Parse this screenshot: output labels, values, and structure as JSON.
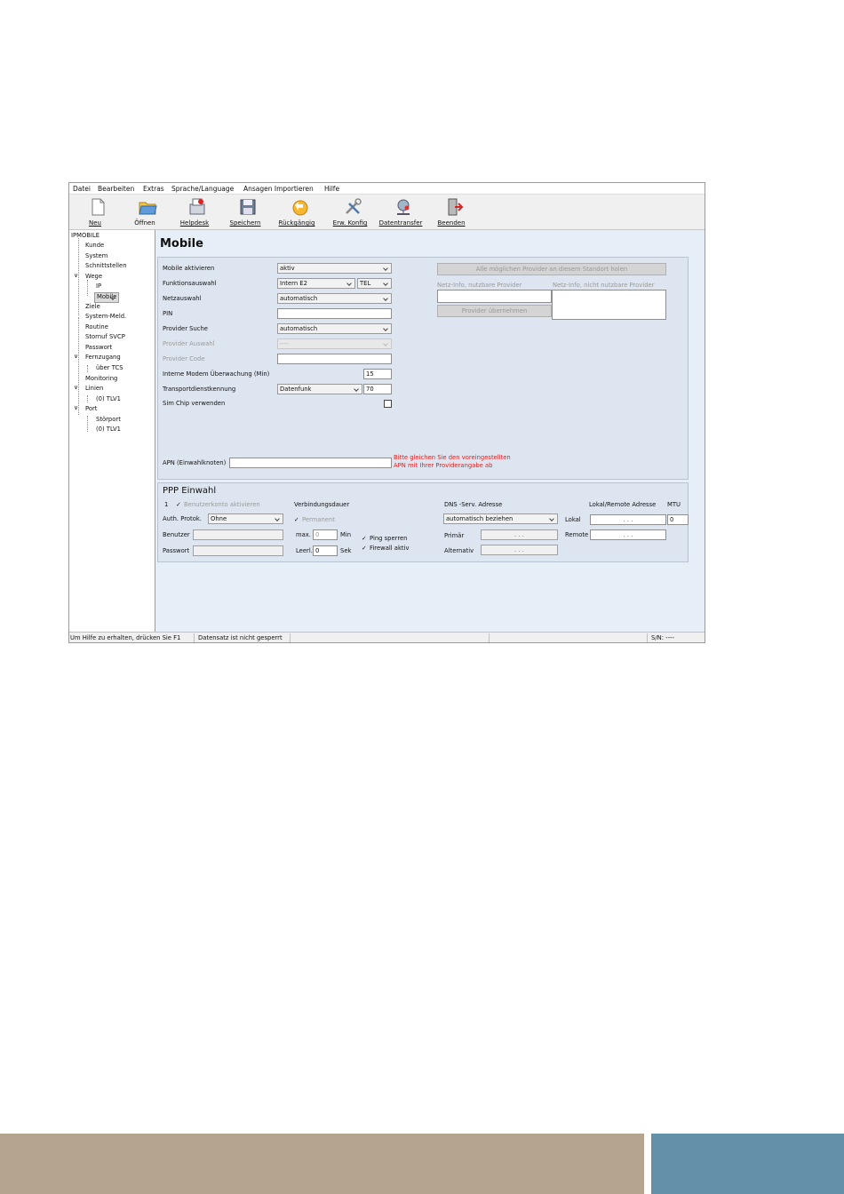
{
  "menu": [
    "Datei",
    "Bearbeiten",
    "Extras",
    "Sprache/Language",
    "Ansagen Importieren",
    "Hilfe"
  ],
  "toolbar": [
    {
      "icon": "new-document-icon",
      "label": "Neu"
    },
    {
      "icon": "open-folder-icon",
      "label": "Öffnen"
    },
    {
      "icon": "helpdesk-icon",
      "label": "Helpdesk"
    },
    {
      "icon": "save-disk-icon",
      "label": "Speichern"
    },
    {
      "icon": "undo-icon",
      "label": "Rückgängig"
    },
    {
      "icon": "tools-icon",
      "label": "Erw. Konfig"
    },
    {
      "icon": "data-transfer-icon",
      "label": "Datentransfer"
    },
    {
      "icon": "exit-door-icon",
      "label": "Beenden"
    }
  ],
  "tree": {
    "root": "IPMOBILE",
    "kunde": "Kunde",
    "system": "System",
    "schnittstellen": "Schnittstellen",
    "wege": "Wege",
    "ip": "IP",
    "mobile": "Mobile",
    "ziele": "Ziele",
    "system_meld": "System-Meld.",
    "routine": "Routine",
    "stornruf": "Stornuf SVCP",
    "passwort": "Passwort",
    "fernzugang": "Fernzugang",
    "ueber_tcs": "über TCS",
    "monitoring": "Monitoring",
    "linien": "Linien",
    "linien_tlv1": "(0) TLV1",
    "port": "Port",
    "stoerport": "Störport",
    "port_tlv1": "(0) TLV1"
  },
  "page": {
    "title": "Mobile",
    "labels": {
      "mobile_aktivieren": "Mobile aktivieren",
      "funktionsauswahl": "Funktionsauswahl",
      "netzauswahl": "Netzauswahl",
      "pin": "PIN",
      "provider_suche": "Provider Suche",
      "provider_auswahl": "Provider Auswahl",
      "provider_code": "Provider Code",
      "modem_ueberwachung": "Interne Modem Überwachung (Min)",
      "transport": "Transportdienstkennung",
      "sim_chip": "Sim Chip verwenden",
      "apn": "APN (Einwahlknoten)"
    },
    "values": {
      "mobile_aktivieren": "aktiv",
      "funktionsauswahl": "Intern E2",
      "funktion_typ": "TEL",
      "netzauswahl": "automatisch",
      "pin": "",
      "provider_suche": "automatisch",
      "provider_auswahl": "----",
      "provider_code": "",
      "modem_ueberwachung": "15",
      "transport": "Datenfunk",
      "transport_nr": "70",
      "apn": ""
    },
    "provider": {
      "fetch_button": "Alle möglichen Provider an diesem Standort holen",
      "usable_label": "Netz-Info, nutzbare Provider",
      "unusable_label": "Netz-Info, nicht nutzbare Provider",
      "take_button": "Provider übernehmen"
    },
    "apn_warning_1": "Bitte gleichen Sie den voreingestellten",
    "apn_warning_2": "APN mit Ihrer Providerangabe ab"
  },
  "ppp": {
    "title": "PPP Einwahl",
    "index": "1",
    "benutzerkonto": "Benutzerkonto aktivieren",
    "auth_label": "Auth. Protok.",
    "auth_value": "Ohne",
    "benutzer": "Benutzer",
    "passwort": "Passwort",
    "verbindungsdauer": "Verbindungsdauer",
    "permanent": "Permanent",
    "max_label": "max.",
    "max_value": "0",
    "min_unit": "Min",
    "leerl_label": "Leerl.",
    "leerl_value": "0",
    "sek_unit": "Sek",
    "ping": "Ping sperren",
    "firewall": "Firewall aktiv",
    "dns_title": "DNS -Serv. Adresse",
    "dns_value": "automatisch beziehen",
    "primaer": "Primär",
    "alternativ": "Alternativ",
    "lokal_remote_title": "Lokal/Remote Adresse",
    "lokal": "Lokal",
    "remote": "Remote",
    "mtu_title": "MTU",
    "mtu_value": "0",
    "ip_placeholder": ".     .     ."
  },
  "status": {
    "help": "Um Hilfe zu erhalten, drücken Sie F1",
    "record": "Datensatz ist nicht gesperrt",
    "sn": "S/N: ----"
  },
  "colors": {
    "footer_left": "#b5a58e",
    "footer_right": "#6490aa",
    "content_bg": "#e6eef7",
    "warning": "#e02020"
  }
}
